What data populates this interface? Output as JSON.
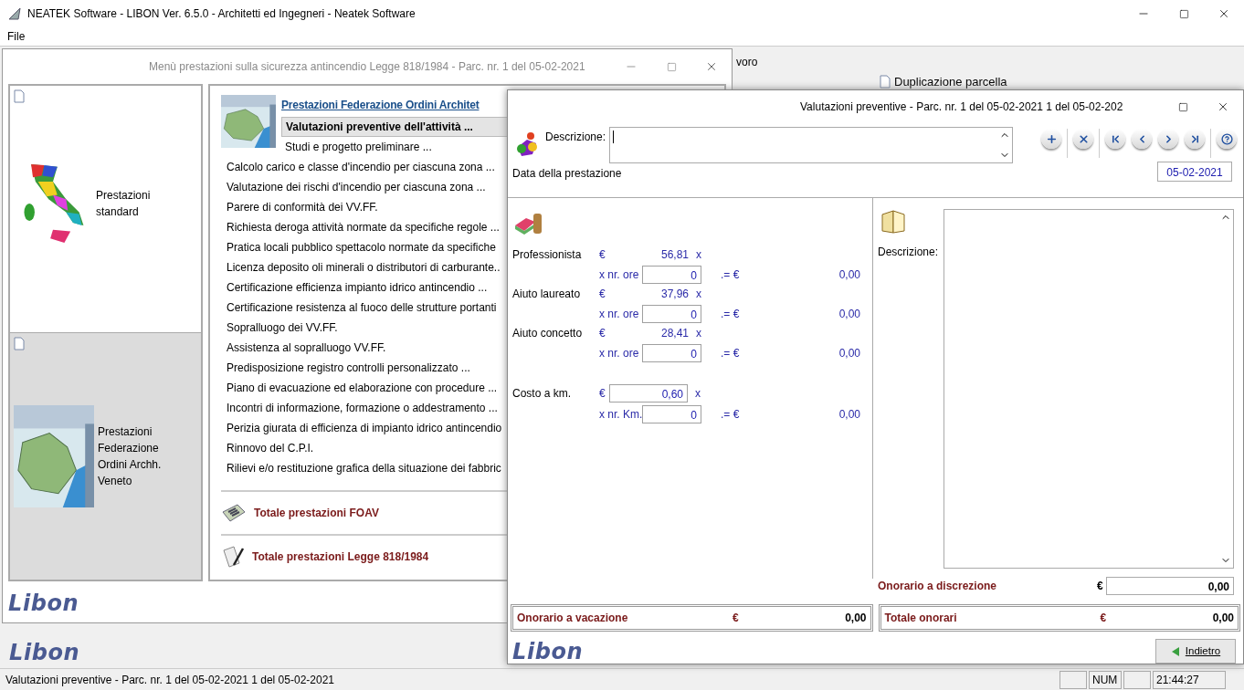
{
  "app": {
    "title": "NEATEK Software - LIBON Ver. 6.5.0 - Architetti ed Ingegneri - Neatek Software",
    "menu": [
      {
        "label": "File"
      }
    ]
  },
  "background": {
    "toolbar_text": "voro",
    "duplicate_label": "Duplicazione parcella",
    "logo": "Libon"
  },
  "menu_window": {
    "title": "Menù prestazioni sulla sicurezza antincendio Legge 818/1984 - Parc. nr. 1  del 05-02-2021",
    "active": false,
    "left_items": [
      {
        "label": "Prestazioni standard",
        "selected": false,
        "kind": "italy"
      },
      {
        "label": "Prestazioni Federazione Ordini Archh. Veneto",
        "selected": true,
        "kind": "veneto"
      }
    ],
    "header_link": "Prestazioni Federazione Ordini Architet",
    "items": [
      {
        "label": "Valutazioni preventive dell'attività ...",
        "selected": true,
        "kind": "sub"
      },
      {
        "label": "Studi e progetto preliminare ...",
        "selected": false,
        "kind": "sub"
      },
      {
        "label": "Calcolo carico e classe d'incendio per ciascuna zona ...",
        "selected": false,
        "kind": "main"
      },
      {
        "label": "Valutazione dei rischi d'incendio per ciascuna zona ...",
        "selected": false,
        "kind": "main"
      },
      {
        "label": "Parere di conformità dei VV.FF.",
        "selected": false,
        "kind": "main"
      },
      {
        "label": "Richiesta deroga attività normate da specifiche regole ...",
        "selected": false,
        "kind": "main"
      },
      {
        "label": "Pratica locali pubblico spettacolo normate da specifiche",
        "selected": false,
        "kind": "main"
      },
      {
        "label": "Licenza deposito oli minerali o distributori di carburante..",
        "selected": false,
        "kind": "main"
      },
      {
        "label": "Certificazione efficienza impianto idrico antincendio ...",
        "selected": false,
        "kind": "main"
      },
      {
        "label": "Certificazione resistenza al fuoco delle strutture portanti",
        "selected": false,
        "kind": "main"
      },
      {
        "label": "Sopralluogo dei VV.FF.",
        "selected": false,
        "kind": "main"
      },
      {
        "label": "Assistenza al sopralluogo VV.FF.",
        "selected": false,
        "kind": "main"
      },
      {
        "label": "Predisposizione registro controlli personalizzato ...",
        "selected": false,
        "kind": "main"
      },
      {
        "label": "Piano di evacuazione ed elaborazione con procedure ...",
        "selected": false,
        "kind": "main"
      },
      {
        "label": "Incontri di informazione, formazione o addestramento ...",
        "selected": false,
        "kind": "main"
      },
      {
        "label": "Perizia giurata di efficienza di impianto idrico antincendio",
        "selected": false,
        "kind": "main"
      },
      {
        "label": "Rinnovo del C.P.I.",
        "selected": false,
        "kind": "main"
      },
      {
        "label": "Rilievi e/o restituzione grafica della situazione dei fabbric",
        "selected": false,
        "kind": "main"
      }
    ],
    "totals": [
      {
        "kind": "calculator",
        "label": "Totale prestazioni FOAV"
      },
      {
        "kind": "pen",
        "label": "Totale prestazioni Legge 818/1984"
      }
    ],
    "logo": "Libon"
  },
  "dialog": {
    "title": "Valutazioni preventive - Parc. nr. 1  del 05-02-2021 1  del 05-02-202",
    "active": true,
    "description_label": "Descrizione:",
    "toolbar": [
      {
        "kind": "add",
        "separator_before": false
      },
      {
        "kind": "delete",
        "separator_before": true
      },
      {
        "kind": "first",
        "separator_before": true
      },
      {
        "kind": "previous",
        "separator_before": false
      },
      {
        "kind": "next",
        "separator_before": false
      },
      {
        "kind": "last",
        "separator_before": false
      },
      {
        "kind": "help",
        "separator_before": true
      }
    ],
    "date_label": "Data della prestazione",
    "date": "05-02-2021",
    "rates": [
      {
        "kind": "hourly",
        "label": "Professionista",
        "currency": "€",
        "rate": "56,81",
        "times": "x",
        "qty_label": "x nr. ore",
        "qty": "0",
        "equals": ".= €",
        "result": "0,00"
      },
      {
        "kind": "hourly",
        "label": "Aiuto laureato",
        "currency": "€",
        "rate": "37,96",
        "times": "x",
        "qty_label": "x nr. ore",
        "qty": "0",
        "equals": ".= €",
        "result": "0,00"
      },
      {
        "kind": "hourly",
        "label": "Aiuto concetto",
        "currency": "€",
        "rate": "28,41",
        "times": "x",
        "qty_label": "x nr. ore",
        "qty": "0",
        "equals": ".= €",
        "result": "0,00"
      },
      {
        "kind": "km",
        "label": "Costo a km.",
        "currency": "€",
        "rate": "0,60",
        "times": "x",
        "qty_label": "x nr. Km.",
        "qty": "0",
        "equals": ".= €",
        "result": "0,00"
      }
    ],
    "notes_label": "Descrizione:",
    "discretion": {
      "label": "Onorario a discrezione",
      "currency": "€",
      "value": "0,00"
    },
    "totals": [
      {
        "label": "Onorario a vacazione",
        "currency": "€",
        "value": "0,00"
      },
      {
        "label": "Totale onorari",
        "currency": "€",
        "value": "0,00"
      }
    ],
    "logo": "Libon",
    "back_button": "Indietro"
  },
  "status_bar": {
    "text": "Valutazioni preventive - Parc. nr. 1  del 05-02-2021 1  del 05-02-2021",
    "panels": [
      {
        "kind": "blank"
      },
      {
        "kind": "text",
        "text": "NUM"
      },
      {
        "kind": "blank"
      },
      {
        "kind": "clock",
        "text": "21:44:27"
      }
    ]
  }
}
